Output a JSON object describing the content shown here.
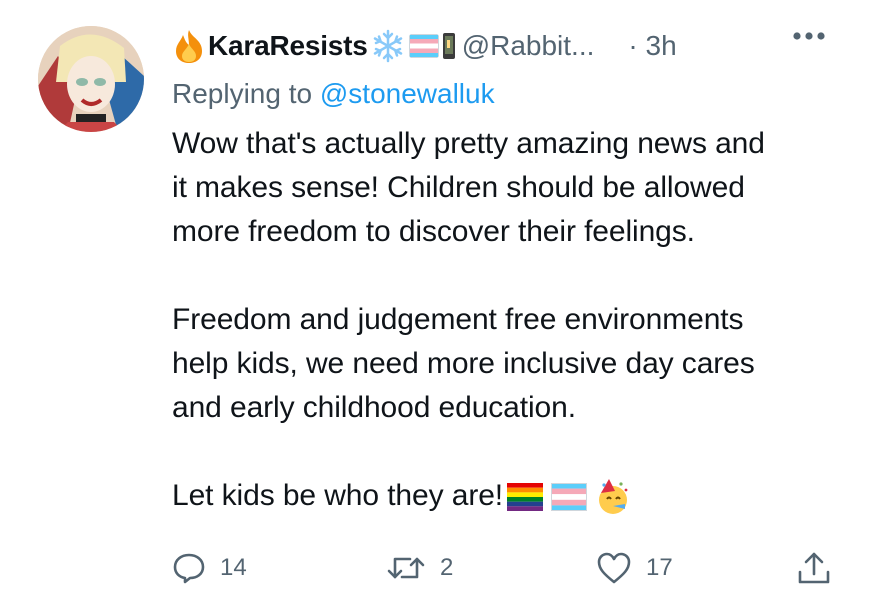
{
  "tweet": {
    "display_name": "KaraResists",
    "handle": "@Rabbit...",
    "time": "· 3h",
    "replying_prefix": "Replying to ",
    "replying_to": "@stonewalluk",
    "paragraphs": [
      [
        "Wow that's actually pretty amazing news and",
        "it makes sense! Children should be allowed",
        "more freedom to discover their feelings."
      ],
      [
        "Freedom and judgement free environments",
        "help kids, we need more inclusive day cares",
        "and early childhood education."
      ],
      [
        "Let kids be who they are!"
      ]
    ],
    "actions": {
      "replies": "14",
      "retweets": "2",
      "likes": "17"
    },
    "icons": {
      "name_emojis": [
        "fire-icon",
        "snowflake-icon",
        "transgender-flag-icon",
        "flagged-phone-icon"
      ],
      "body_emojis": [
        "rainbow-flag-icon",
        "transgender-flag-icon",
        "party-face-icon"
      ]
    },
    "colors": {
      "text": "#0f1419",
      "secondary": "#536471",
      "link": "#1d9bf0"
    }
  }
}
